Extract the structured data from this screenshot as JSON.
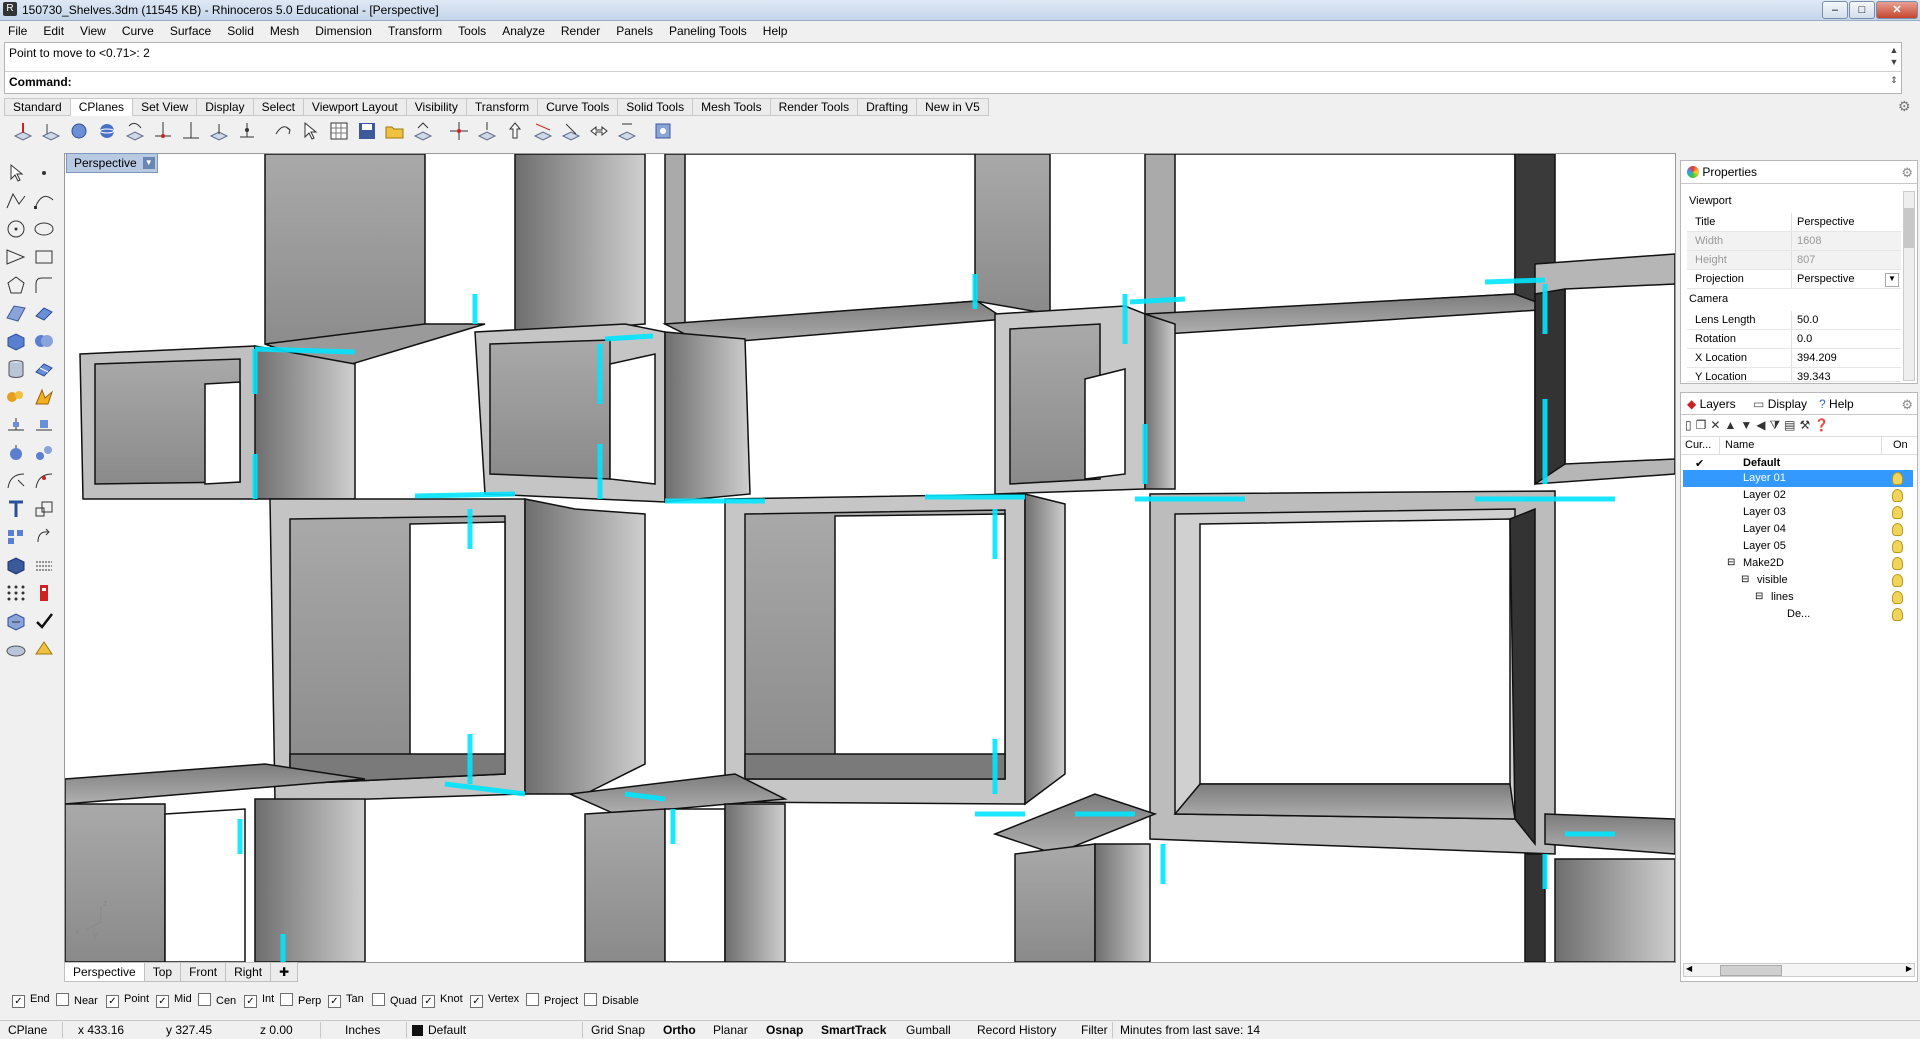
{
  "window": {
    "title": "150730_Shelves.3dm (11545 KB) - Rhinoceros 5.0 Educational - [Perspective]",
    "min": "–",
    "max": "□",
    "close": "✕"
  },
  "menu": [
    "File",
    "Edit",
    "View",
    "Curve",
    "Surface",
    "Solid",
    "Mesh",
    "Dimension",
    "Transform",
    "Tools",
    "Analyze",
    "Render",
    "Panels",
    "Paneling Tools",
    "Help"
  ],
  "command": {
    "history": "Point to move to <0.71>: 2",
    "label": "Command:",
    "value": ""
  },
  "toolbar_tabs": [
    "Standard",
    "CPlanes",
    "Set View",
    "Display",
    "Select",
    "Viewport Layout",
    "Visibility",
    "Transform",
    "Curve Tools",
    "Solid Tools",
    "Mesh Tools",
    "Render Tools",
    "Drafting",
    "New in V5"
  ],
  "active_toolbar_tab": "CPlanes",
  "viewport": {
    "label": "Perspective",
    "axis_z": "z",
    "axis_x": "x",
    "axis_y": "y"
  },
  "viewport_tabs": [
    "Perspective",
    "Top",
    "Front",
    "Right"
  ],
  "viewport_add": "✚",
  "osnaps": [
    {
      "label": "End",
      "checked": true
    },
    {
      "label": "Near",
      "checked": false
    },
    {
      "label": "Point",
      "checked": true
    },
    {
      "label": "Mid",
      "checked": true
    },
    {
      "label": "Cen",
      "checked": false
    },
    {
      "label": "Int",
      "checked": true
    },
    {
      "label": "Perp",
      "checked": false
    },
    {
      "label": "Tan",
      "checked": true
    },
    {
      "label": "Quad",
      "checked": false
    },
    {
      "label": "Knot",
      "checked": true
    },
    {
      "label": "Vertex",
      "checked": true
    },
    {
      "label": "Project",
      "checked": false
    },
    {
      "label": "Disable",
      "checked": false
    }
  ],
  "status": {
    "cplane": "CPlane",
    "x": "x 433.16",
    "y": "y 327.45",
    "z": "z 0.00",
    "units": "Inches",
    "layer": "Default",
    "grid_snap": "Grid Snap",
    "ortho": "Ortho",
    "planar": "Planar",
    "osnap": "Osnap",
    "smarttrack": "SmartTrack",
    "gumball": "Gumball",
    "record_history": "Record History",
    "filter": "Filter",
    "save_info": "Minutes from last save: 14"
  },
  "properties": {
    "tab": "Properties",
    "section_viewport": "Viewport",
    "rows_viewport": [
      {
        "key": "Title",
        "value": "Perspective"
      },
      {
        "key": "Width",
        "value": "1608"
      },
      {
        "key": "Height",
        "value": "807"
      },
      {
        "key": "Projection",
        "value": "Perspective"
      }
    ],
    "section_camera": "Camera",
    "rows_camera": [
      {
        "key": "Lens Length",
        "value": "50.0"
      },
      {
        "key": "Rotation",
        "value": "0.0"
      },
      {
        "key": "X Location",
        "value": "394.209"
      },
      {
        "key": "Y Location",
        "value": "39.343"
      }
    ]
  },
  "layers": {
    "tabs": [
      "Layers",
      "Display",
      "Help"
    ],
    "col_current": "Cur...",
    "col_name": "Name",
    "col_on": "On",
    "rows": [
      {
        "name": "Default",
        "indent": 0,
        "current": true,
        "bold": true,
        "selected": false
      },
      {
        "name": "Layer 01",
        "indent": 1,
        "current": false,
        "bold": false,
        "selected": true
      },
      {
        "name": "Layer 02",
        "indent": 1,
        "current": false,
        "bold": false,
        "selected": false
      },
      {
        "name": "Layer 03",
        "indent": 1,
        "current": false,
        "bold": false,
        "selected": false
      },
      {
        "name": "Layer 04",
        "indent": 1,
        "current": false,
        "bold": false,
        "selected": false
      },
      {
        "name": "Layer 05",
        "indent": 1,
        "current": false,
        "bold": false,
        "selected": false
      },
      {
        "name": "Make2D",
        "indent": 0,
        "current": false,
        "bold": false,
        "selected": false,
        "expander": "⊟"
      },
      {
        "name": "visible",
        "indent": 1,
        "current": false,
        "bold": false,
        "selected": false,
        "expander": "⊟"
      },
      {
        "name": "lines",
        "indent": 2,
        "current": false,
        "bold": false,
        "selected": false,
        "expander": "⊟"
      },
      {
        "name": "De...",
        "indent": 3,
        "current": false,
        "bold": false,
        "selected": false
      }
    ]
  },
  "colors": {
    "accent": "#3399ff",
    "highlight": "#00e5ff",
    "selection": "#3399ff",
    "viewport_bg": "#ffffff",
    "panel_bg": "#f0f0f0"
  }
}
